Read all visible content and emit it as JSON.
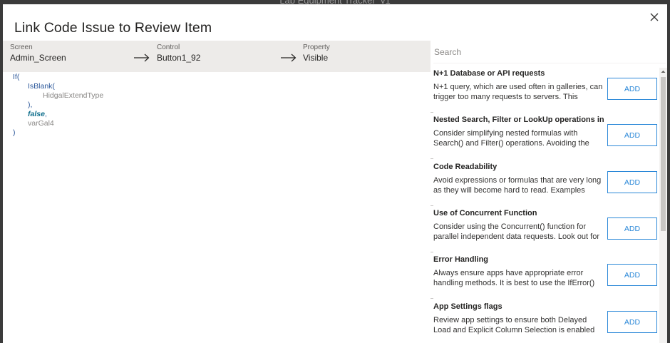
{
  "app": {
    "window_title": "Lab Equipment Tracker_v1"
  },
  "dialog": {
    "title": "Link Code Issue to Review Item",
    "close_icon": "close-icon"
  },
  "breadcrumb": {
    "screen_label": "Screen",
    "screen_value": "Admin_Screen",
    "control_label": "Control",
    "control_value": "Button1_92",
    "property_label": "Property",
    "property_value": "Visible",
    "arrow_icon": "arrow-right-icon"
  },
  "code": {
    "if": "If(",
    "isblank": "IsBlank(",
    "arg": "HidgalExtendType",
    "close_paren_comma": "),",
    "false": "false",
    "comma": ",",
    "var": "varGal4",
    "close_paren": ")"
  },
  "search": {
    "placeholder": "Search",
    "value": ""
  },
  "add_label": "ADD",
  "items": [
    {
      "title": "N+1 Database or API requests",
      "desc": "N+1 query, which are used often in galleries, can trigger too many requests to servers. This"
    },
    {
      "title": "Nested Search, Filter or LookUp operations in",
      "desc": "Consider simplifying nested formulas with Search() and Filter() operations. Avoiding the"
    },
    {
      "title": "Code Readability",
      "desc": "Avoid expressions or formulas that are very long as they will become hard to read. Examples"
    },
    {
      "title": "Use of Concurrent Function",
      "desc": "Consider using the Concurrent() function for parallel independent data requests. Look out for"
    },
    {
      "title": "Error Handling",
      "desc": "Always ensure apps have appropriate error handling methods. It is best to use the IfError()"
    },
    {
      "title": "App Settings flags",
      "desc": "Review app settings to ensure both Delayed Load and Explicit Column Selection is enabled to"
    }
  ],
  "colors": {
    "accent": "#2b88d8",
    "breadcrumb_bg": "#edebe9",
    "code_keyword": "#2b579a"
  }
}
